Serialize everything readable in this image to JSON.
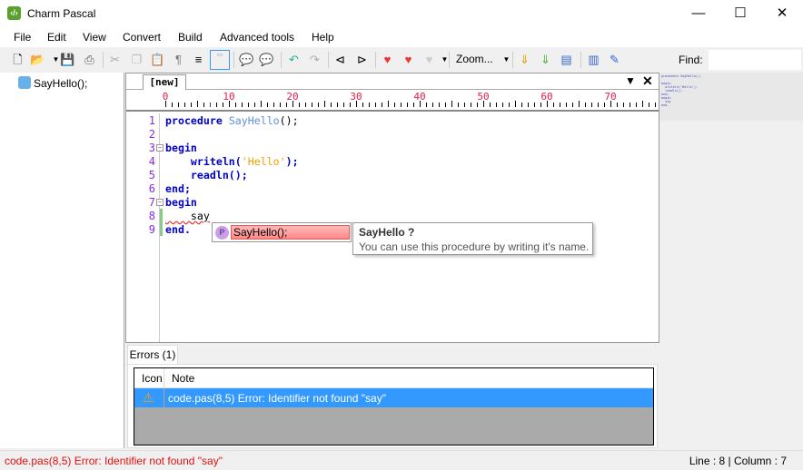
{
  "window": {
    "title": "Charm Pascal",
    "minimize": "—",
    "maximize": "☐",
    "close": "✕"
  },
  "menu": [
    "File",
    "Edit",
    "View",
    "Convert",
    "Build",
    "Advanced tools",
    "Help"
  ],
  "toolbar": {
    "zoom_label": "Zoom...",
    "find_label": "Find:",
    "find_value": ""
  },
  "tree": {
    "items": [
      {
        "label": "SayHello();"
      }
    ]
  },
  "editor": {
    "tab": "[new]",
    "ruler_labels": [
      "0",
      "10",
      "20",
      "30",
      "40",
      "50",
      "60",
      "70"
    ],
    "line_numbers": [
      "1",
      "2",
      "3",
      "4",
      "5",
      "6",
      "7",
      "8",
      "9"
    ]
  },
  "code": {
    "l1_kw": "procedure",
    "l1_fn": "SayHello",
    "l1_rest": "();",
    "l3": "begin",
    "l4_a": "    writeln(",
    "l4_str": "'Hello'",
    "l4_b": ");",
    "l5": "    readln();",
    "l6": "end;",
    "l7": "begin",
    "l8": "    say",
    "l9": "end."
  },
  "autocomplete": {
    "badge": "P",
    "item": "SayHello();"
  },
  "tooltip": {
    "title": "SayHello ?",
    "body": "You can use this procedure by writing it's name."
  },
  "errors": {
    "tab": "Errors (1)",
    "columns": [
      "Icon",
      "Note"
    ],
    "rows": [
      {
        "note": "code.pas(8,5) Error: Identifier not found \"say\""
      }
    ]
  },
  "status": {
    "message": "code.pas(8,5) Error: Identifier not found \"say\"",
    "position": "Line : 8 | Column : 7"
  }
}
